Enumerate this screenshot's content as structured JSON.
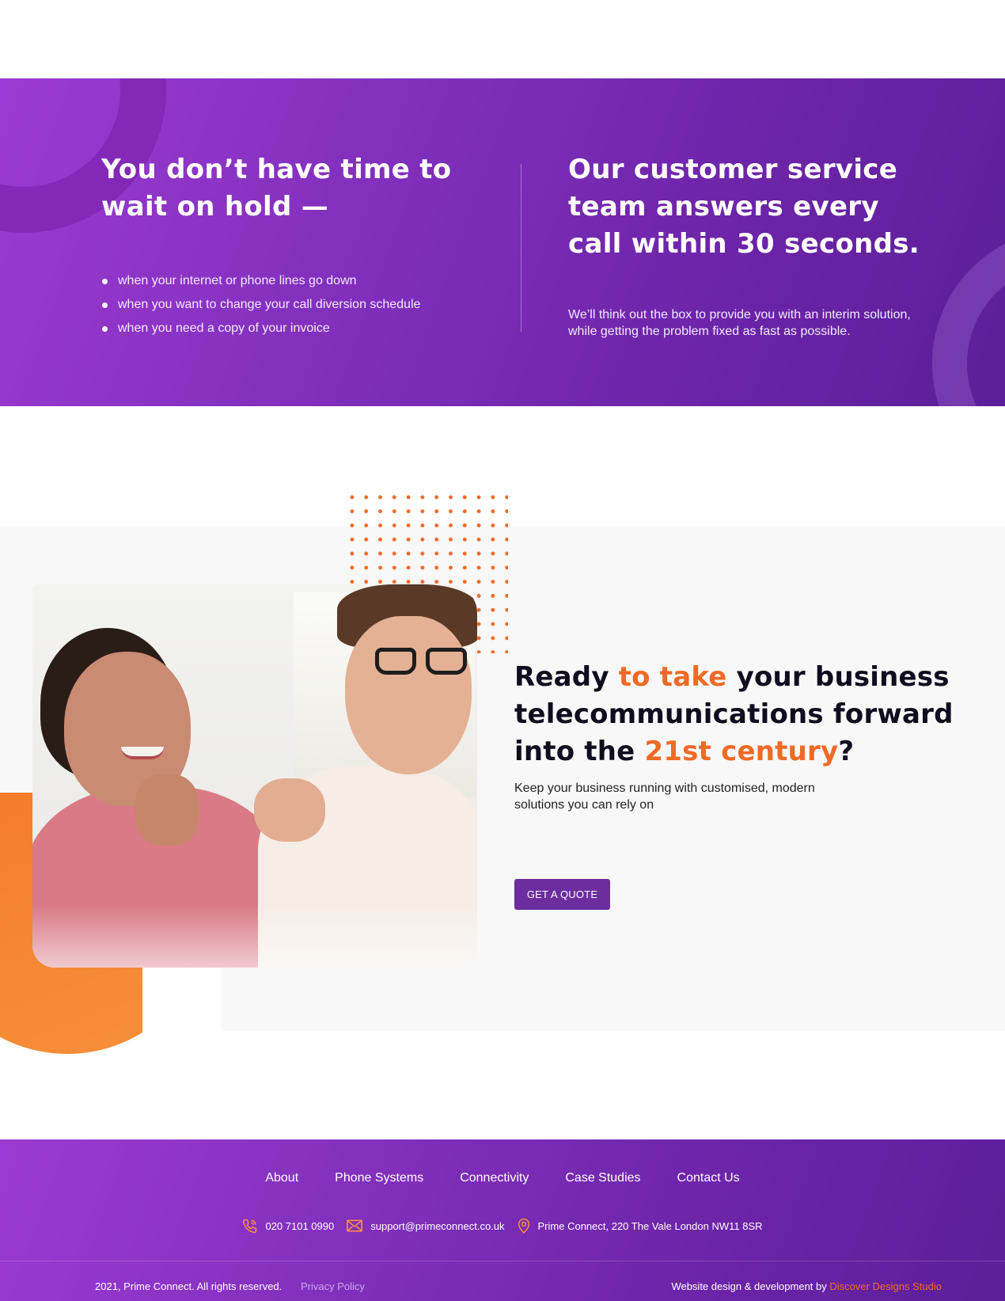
{
  "hero": {
    "heading_left_line1": "You don’t have time to",
    "heading_left_line2": "wait on hold —",
    "bullets": [
      "when your internet or phone lines go down",
      "when you want to change your call diversion schedule",
      "when you need a copy of your invoice"
    ],
    "heading_right_line1": "Our customer service",
    "heading_right_line2": "team answers every",
    "heading_right_line3": "call within 30 seconds.",
    "subtext_line1": "We’ll think out the box to provide you with an interim solution,",
    "subtext_line2": "while getting the problem fixed as fast as possible."
  },
  "cta": {
    "heading_part1": "Ready ",
    "heading_hl1": "to take",
    "heading_part2": " your business telecommunications forward into the ",
    "heading_hl2": "21st century",
    "heading_part3": "?",
    "subtext": "Keep your business running with customised, modern solutions you can rely on",
    "button_label": "GET A QUOTE"
  },
  "footer": {
    "nav": [
      "About",
      "Phone Systems",
      "Connectivity",
      "Case Studies",
      "Contact Us"
    ],
    "phone": "020 7101 0990",
    "email": "support@primeconnect.co.uk",
    "address": "Prime Connect, 220 The Vale London NW11 8SR",
    "copyright": "2021, Prime Connect. All rights reserved.",
    "privacy": "Privacy Policy",
    "credit_prefix": "Website design & development by ",
    "credit_studio": "Discover Designs Studio"
  },
  "icons": {
    "phone": "phone-icon",
    "email": "envelope-icon",
    "address": "map-pin-icon"
  },
  "colors": {
    "purple_start": "#9b3ad2",
    "purple_end": "#5b1f99",
    "orange_accent": "#ef6a25",
    "button": "#6c2d9e",
    "heading_dark": "#0f0d1e"
  }
}
